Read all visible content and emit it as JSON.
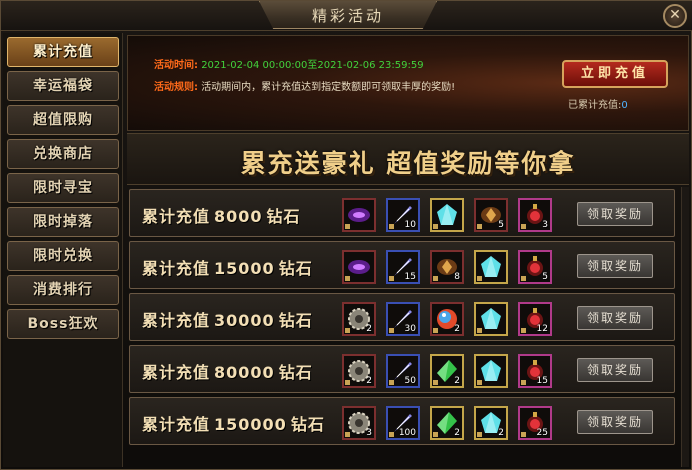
{
  "window": {
    "title": "精彩活动",
    "close_label": "✕"
  },
  "sidebar": {
    "items": [
      {
        "label": "累计充值",
        "active": true
      },
      {
        "label": "幸运福袋",
        "active": false
      },
      {
        "label": "超值限购",
        "active": false
      },
      {
        "label": "兑换商店",
        "active": false
      },
      {
        "label": "限时寻宝",
        "active": false
      },
      {
        "label": "限时掉落",
        "active": false
      },
      {
        "label": "限时兑换",
        "active": false
      },
      {
        "label": "消费排行",
        "active": false
      },
      {
        "label": "Boss狂欢",
        "active": false
      }
    ]
  },
  "header": {
    "time_label": "活动时间:",
    "time_value": "2021-02-04 00:00:00至2021-02-06 23:59:59",
    "rule_label": "活动规则:",
    "rule_value": "活动期间内，累计充值达到指定数额即可领取丰厚的奖励!",
    "charge_button": "立即充值",
    "total_label": "已累计充值:",
    "total_value": "0"
  },
  "slogan": "累充送豪礼  超值奖励等你拿",
  "rows": [
    {
      "prefix": "累计充值",
      "amount": "8000",
      "unit": "钻石",
      "button": "领取奖励",
      "items": [
        {
          "icon": "vortex-icon",
          "count": ""
        },
        {
          "icon": "feather-icon",
          "count": "10"
        },
        {
          "icon": "ice-crystal-icon",
          "count": ""
        },
        {
          "icon": "amber-ore-icon",
          "count": "5"
        },
        {
          "icon": "ruby-amulet-icon",
          "count": "3"
        }
      ]
    },
    {
      "prefix": "累计充值",
      "amount": "15000",
      "unit": "钻石",
      "button": "领取奖励",
      "items": [
        {
          "icon": "vortex-icon",
          "count": ""
        },
        {
          "icon": "feather-icon",
          "count": "15"
        },
        {
          "icon": "amber-ore-icon",
          "count": "8"
        },
        {
          "icon": "ice-crystal-icon",
          "count": ""
        },
        {
          "icon": "ruby-amulet-icon",
          "count": "5"
        }
      ]
    },
    {
      "prefix": "累计充值",
      "amount": "30000",
      "unit": "钻石",
      "button": "领取奖励",
      "items": [
        {
          "icon": "gear-medal-icon",
          "count": "2"
        },
        {
          "icon": "feather-icon",
          "count": "30"
        },
        {
          "icon": "rainbow-orb-icon",
          "count": "2"
        },
        {
          "icon": "ice-crystal-icon",
          "count": ""
        },
        {
          "icon": "ruby-amulet-icon",
          "count": "12"
        }
      ]
    },
    {
      "prefix": "累计充值",
      "amount": "80000",
      "unit": "钻石",
      "button": "领取奖励",
      "items": [
        {
          "icon": "gear-medal-icon",
          "count": "2"
        },
        {
          "icon": "feather-icon",
          "count": "50"
        },
        {
          "icon": "emerald-crystal-icon",
          "count": "2"
        },
        {
          "icon": "ice-crystal-icon",
          "count": ""
        },
        {
          "icon": "ruby-amulet-icon",
          "count": "15"
        }
      ]
    },
    {
      "prefix": "累计充值",
      "amount": "150000",
      "unit": "钻石",
      "button": "领取奖励",
      "items": [
        {
          "icon": "gear-medal-icon",
          "count": "3"
        },
        {
          "icon": "feather-icon",
          "count": "100"
        },
        {
          "icon": "emerald-crystal-icon",
          "count": "2"
        },
        {
          "icon": "ice-crystal-icon",
          "count": "2"
        },
        {
          "icon": "ruby-amulet-icon",
          "count": "25"
        }
      ]
    }
  ],
  "colors": {
    "accent_orange": "#ff6a1a",
    "time_green": "#42d23c",
    "gold_text": "#f3dfb5",
    "charge_red": "#b42a1e",
    "total_blue": "#4fb3ff"
  }
}
